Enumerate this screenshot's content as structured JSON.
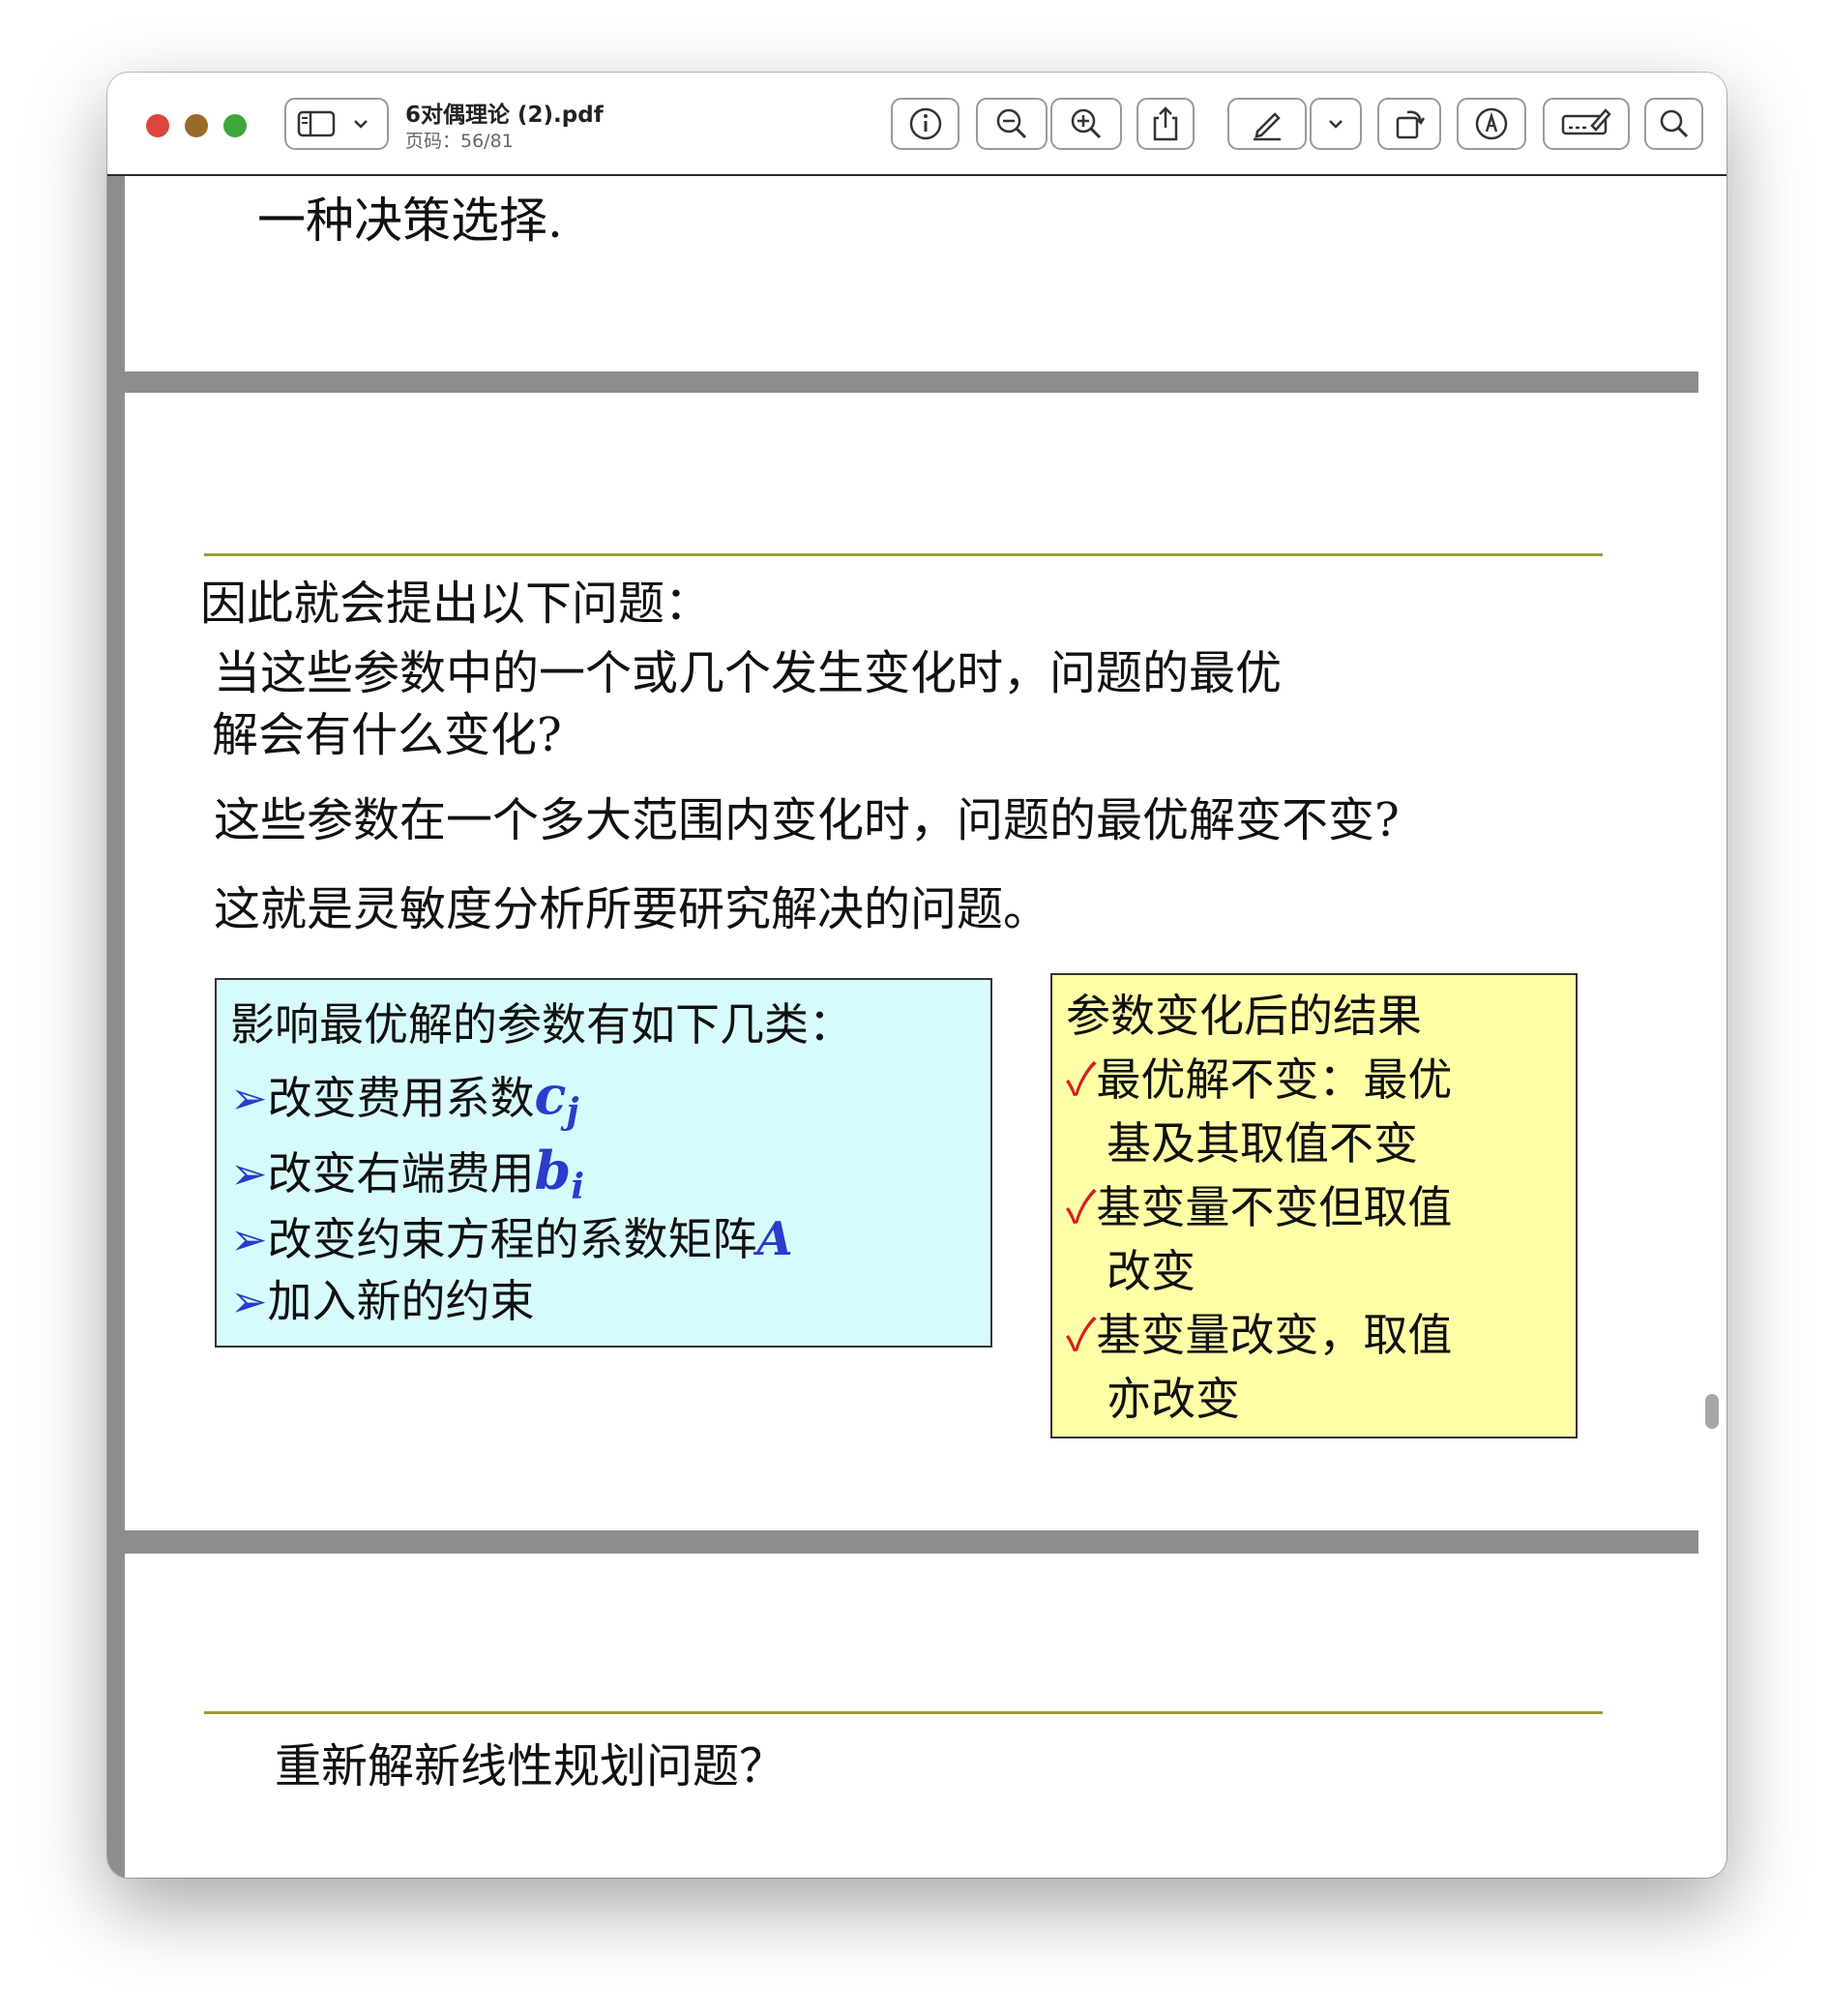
{
  "window": {
    "doc_title": "6对偶理论 (2).pdf",
    "page_indicator": "页码：56/81"
  },
  "page_prev": {
    "text": "一种决策选择."
  },
  "page_current": {
    "heading": "因此就会提出以下问题：",
    "q1_line1": "当这些参数中的一个或几个发生变化时，问题的最优",
    "q1_line2": "解会有什么变化?",
    "q2": "这些参数在一个多大范围内变化时，问题的最优解变不变?",
    "q3": "这就是灵敏度分析所要研究解决的问题。",
    "left_box": {
      "title": "影响最优解的参数有如下几类：",
      "arrow": "➢",
      "items": [
        {
          "text": "改变费用系数",
          "var": "c",
          "sub": "j"
        },
        {
          "text": "改变右端费用",
          "var": "b",
          "sub": "i"
        },
        {
          "text": "改变约束方程的系数矩阵",
          "var": "A",
          "sub": ""
        },
        {
          "text": "加入新的约束",
          "var": "",
          "sub": ""
        }
      ]
    },
    "right_box": {
      "title": "参数变化后的结果",
      "check": "✓",
      "items": [
        {
          "line1": "最优解不变：最优",
          "line2": "基及其取值不变"
        },
        {
          "line1": "基变量不变但取值",
          "line2": "改变"
        },
        {
          "line1": "基变量改变，取值",
          "line2": "亦改变"
        }
      ]
    }
  },
  "page_next": {
    "text": "重新解新线性规划问题？"
  },
  "colors": {
    "page_separator": "#8d8d8d",
    "rule": "#9c9a3a",
    "left_box_bg": "#d7fbfd",
    "right_box_bg": "#fffea6",
    "accent_blue": "#2c3bc9",
    "check_red": "#d42020"
  }
}
